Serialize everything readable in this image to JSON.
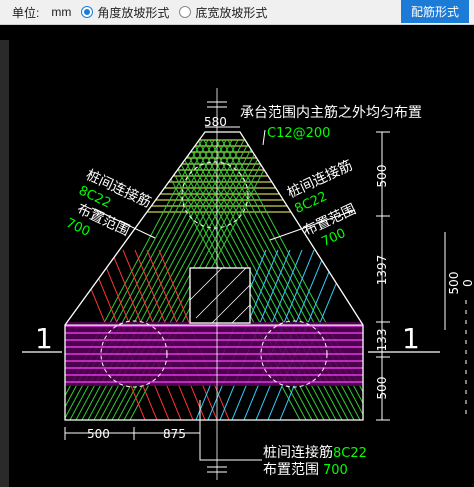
{
  "toolbar": {
    "unit_label": "单位:",
    "unit_value": "mm",
    "option_angle": "角度放坡形式",
    "option_width": "底宽放坡形式",
    "selected": "angle",
    "button_label": "配筋形式"
  },
  "drawing": {
    "top_dim": "580",
    "main_note": "承台范围内主筋之外均匀布置",
    "main_spec": "C12@200",
    "left_pile_label": "桩间连接筋",
    "left_spec": "8C22",
    "left_range_label": "布置范围",
    "left_range_value": "700",
    "right_pile_label": "桩间连接筋",
    "right_spec": "8C22",
    "right_range_label": "布置范围",
    "right_range_value": "700",
    "bottom_pile_label": "桩间连接筋",
    "bottom_spec": "8C22",
    "bottom_range_label": "布置范围",
    "bottom_range_value": "700",
    "dim_r1": "500",
    "dim_r2": "1397",
    "dim_r3": "133",
    "dim_r4": "500",
    "dim_b1": "500",
    "dim_b2": "875",
    "dim_far": "500",
    "dim_far2": "0",
    "section_left": "1",
    "section_right": "1"
  },
  "colors": {
    "accent": "#1c7bd6",
    "green_text": "#00ff00",
    "rebar_green": "#33cc33",
    "rebar_yellow": "#ffff66",
    "rebar_magenta": "#ff44ff",
    "rebar_red": "#ff3333",
    "rebar_cyan": "#33ccff"
  }
}
